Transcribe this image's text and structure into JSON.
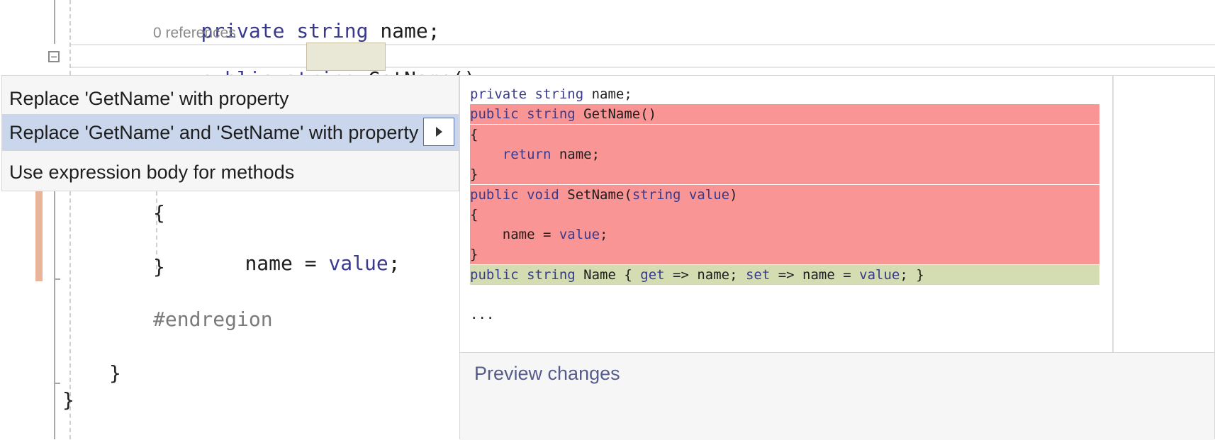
{
  "editor": {
    "line_field": [
      "private",
      " ",
      "string",
      " ",
      "name;"
    ],
    "references": "0 references",
    "line_method": [
      "public",
      " ",
      "string",
      " ",
      "GetName",
      "()"
    ],
    "brace_open": "{",
    "assign": [
      "name",
      " = ",
      "value",
      ";"
    ],
    "brace_close": "}",
    "endregion": "#endregion",
    "outer_brace": "}",
    "last_brace": "}",
    "collapse_glyph": "−"
  },
  "menu": {
    "items": [
      {
        "label": "Replace 'GetName' with property"
      },
      {
        "label": "Replace 'GetName' and 'SetName' with property",
        "selected": true
      },
      {
        "label": "Use expression body for methods"
      }
    ]
  },
  "preview": {
    "lines": [
      {
        "type": "context",
        "tokens": [
          {
            "t": "private",
            "k": "kw"
          },
          {
            "t": " "
          },
          {
            "t": "string",
            "k": "kw"
          },
          {
            "t": " name;"
          }
        ]
      },
      {
        "type": "removed",
        "tokens": [
          {
            "t": "public",
            "k": "kw"
          },
          {
            "t": " "
          },
          {
            "t": "string",
            "k": "kw"
          },
          {
            "t": " GetName()"
          }
        ]
      },
      {
        "type": "removed",
        "tokens": [
          {
            "t": "{"
          }
        ]
      },
      {
        "type": "removed",
        "tokens": [
          {
            "t": "    "
          },
          {
            "t": "return",
            "k": "kw"
          },
          {
            "t": " name;"
          }
        ]
      },
      {
        "type": "removed",
        "tokens": [
          {
            "t": "}"
          }
        ]
      },
      {
        "type": "removed",
        "tokens": [
          {
            "t": "public",
            "k": "kw"
          },
          {
            "t": " "
          },
          {
            "t": "void",
            "k": "kw"
          },
          {
            "t": " SetName("
          },
          {
            "t": "string",
            "k": "kw"
          },
          {
            "t": " "
          },
          {
            "t": "value",
            "k": "kw"
          },
          {
            "t": ")"
          }
        ]
      },
      {
        "type": "removed",
        "tokens": [
          {
            "t": "{"
          }
        ]
      },
      {
        "type": "removed",
        "tokens": [
          {
            "t": "    name = "
          },
          {
            "t": "value",
            "k": "kw"
          },
          {
            "t": ";"
          }
        ]
      },
      {
        "type": "removed",
        "tokens": [
          {
            "t": "}"
          }
        ]
      },
      {
        "type": "added",
        "tokens": [
          {
            "t": "public",
            "k": "kw"
          },
          {
            "t": " "
          },
          {
            "t": "string",
            "k": "kw"
          },
          {
            "t": " Name { "
          },
          {
            "t": "get",
            "k": "kw"
          },
          {
            "t": " => name; "
          },
          {
            "t": "set",
            "k": "kw"
          },
          {
            "t": " => name = "
          },
          {
            "t": "value",
            "k": "kw"
          },
          {
            "t": "; }"
          }
        ]
      },
      {
        "type": "context",
        "tokens": [
          {
            "t": ""
          }
        ]
      },
      {
        "type": "context",
        "tokens": [
          {
            "t": "..."
          }
        ]
      }
    ],
    "footer_link": "Preview changes"
  },
  "colors": {
    "removed_bg": "#f99595",
    "added_bg": "#d4ddb2",
    "menu_selected_bg": "#c9d6ec",
    "keyword": "#3a3a8c",
    "change_bar": "#e8b59a"
  }
}
